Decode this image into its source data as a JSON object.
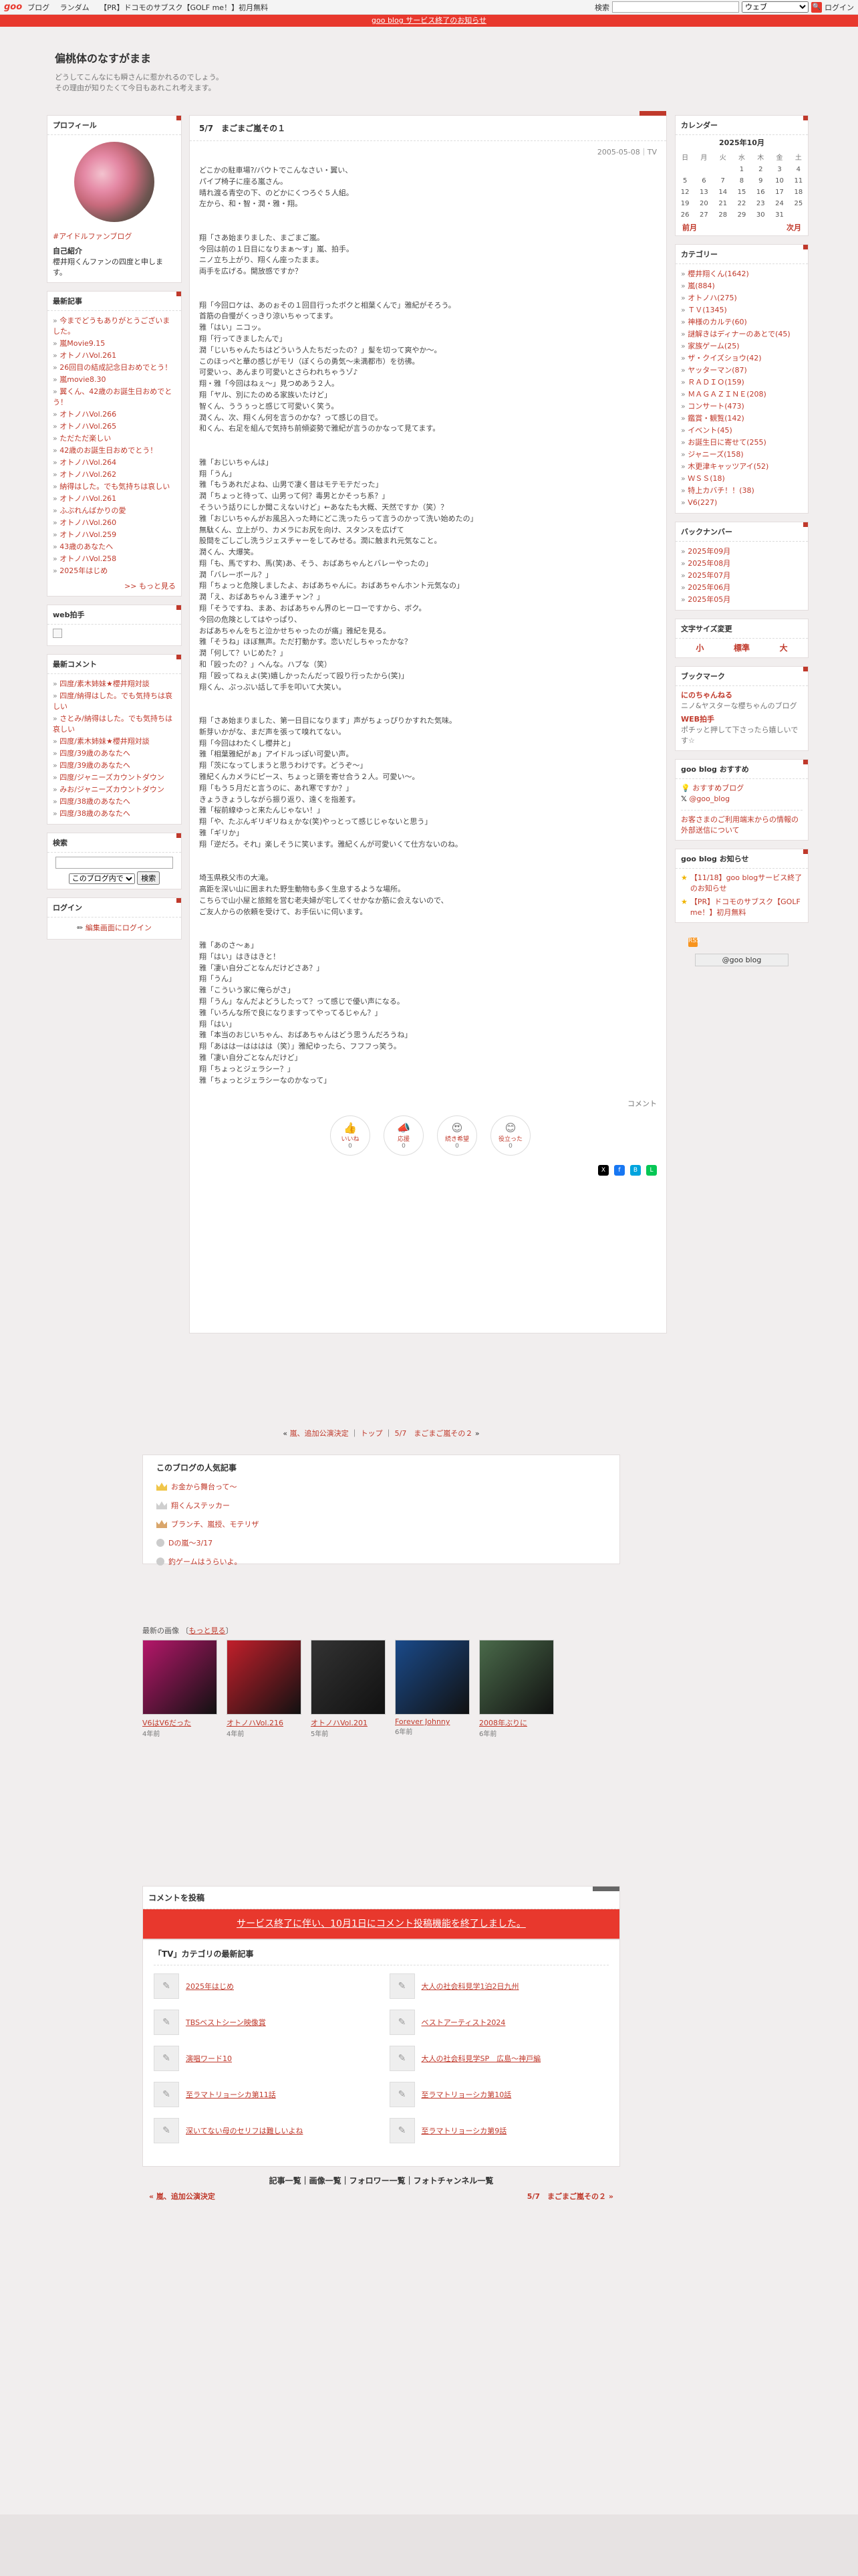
{
  "topbar": {
    "logo": "goo",
    "nav": [
      "ブログ",
      "ランダム",
      "【PR】ドコモのサブスク【GOLF me！】初月無料"
    ],
    "search_label": "検索",
    "search_select": "ウェブ",
    "login": "ログイン"
  },
  "banner": "goo blog サービス終了のお知らせ",
  "blog": {
    "title": "偏桃体のなすがまま",
    "desc1": "どうしてこんなにも瞬さんに惹かれるのでしょう。",
    "desc2": "その理由が知りたくて今日もあれこれ考えます。"
  },
  "profile": {
    "title": "プロフィール",
    "name": "#アイドルファンブログ",
    "intro_label": "自己紹介",
    "intro": "櫻井翔くんファンの四度と申します。"
  },
  "recent": {
    "title": "最新記事",
    "items": [
      "今までどうもありがとうございました。",
      "嵐Movie9.15",
      "オトノハVol.261",
      "26回目の結成記念日おめでとう！",
      "嵐movie8.30",
      "翼くん、42歳のお誕生日おめでとう！",
      "オトノハVol.266",
      "オトノハVol.265",
      "ただただ楽しい",
      "42歳のお誕生日おめでとう！",
      "オトノハVol.264",
      "オトノハVol.262",
      "納得はした。でも気持ちは哀しい",
      "オトノハVol.261",
      "ふぶれんばかりの愛",
      "オトノハVol.260",
      "オトノハVol.259",
      "43歳のあなたへ",
      "オトノハVol.258",
      "2025年はじめ"
    ],
    "more": ">> もっと見る"
  },
  "webclip": {
    "title": "web拍手"
  },
  "comments": {
    "title": "最新コメント",
    "items": [
      "四度/素木姉妹★櫻井翔対談",
      "四度/納得はした。でも気持ちは哀しい",
      "さとみ/納得はした。でも気持ちは哀しい",
      "四度/素木姉妹★櫻井翔対談",
      "四度/39歳のあなたへ",
      "四度/39歳のあなたへ",
      "四度/ジャニーズカウントダウン",
      "みお/ジャニーズカウントダウン",
      "四度/38歳のあなたへ",
      "四度/38歳のあなたへ"
    ]
  },
  "search": {
    "title": "検索",
    "select": "このブログ内で",
    "button": "検索"
  },
  "login": {
    "title": "ログイン",
    "link": "編集画面にログイン"
  },
  "entry": {
    "title": "5/7　まごまご嵐その１",
    "date": "2005-05-08｜TV",
    "lines": [
      "どこかの駐車場?/バウトでこんなさい・翼い、",
      "パイプ椅子に座る嵐さん。",
      "晴れ渡る青空の下、のどかにくつろぐ５人組。",
      "左から、和・智・潤・雅・翔。",
      "",
      "",
      "翔「さあ始まりました、まごまご嵐。",
      "今回は前の１日目になりまぁ～す」嵐、拍手。",
      "ニノ立ち上がり、翔くん座ったまま。",
      "両手を広げる。開放感ですか？",
      "",
      "",
      "翔「今回ロケは、あのぉその１回目行ったボクと相葉くんで」雅紀がそろう。",
      "首筋の自慢がくっきり涼いちゃってます。",
      "雅「はい」ニコッ。",
      "翔「行ってきましたんで」",
      "潤「じいちゃんたちはどういう人たちだったの？」髪を切って爽やか～。",
      "このほっぺと華の感じがモリ（ぼくらの勇気～未満都市）を彷彿。",
      "可愛いっ、あんまり可愛いとさらわれちゃうゾ♪",
      "翔・雅「今回はねぇ～」見つめあう２人。",
      "翔「ヤル、別にたのめる家族いたけど」",
      "智くん、ううぅっと感じて可愛いく笑う。",
      "潤くん、次、翔くん何を言うのかな？って感じの目で。",
      "和くん、右足を組んで気持ち前傾姿勢で雅紀が言うのかなって見てます。",
      "",
      "",
      "雅「おじいちゃんは」",
      "翔「うん」",
      "雅「もうあれだよね、山男で凄く昔はモテモテだった」",
      "潤「ちょっと待って、山男って何？毒男とかそっち系？」",
      "そういう話りにしか聞こえないけど」←あなたも大概、天然ですか（笑）？",
      "雅「おじいちゃんがお風呂入った時にどこ洗ったらって言うのかって洗い始めたの」",
      "無駄くん、立上がり、カメラにお尻を向け、スタンスを広げて",
      "股間をごしごし洗うジェスチャーをしてみせる。潤に触まれ元気なこと。",
      "潤くん、大爆笑。",
      "翔「も、馬ですわ、馬(笑)あ、そう、おばあちゃんとバレーやったの」",
      "潤「バレーボール？」",
      "翔「ちょっと危険しましたよ、おばあちゃんに。おばあちゃんホント元気なの」",
      "潤「え、おばあちゃん３連チャン？」",
      "翔「そうですね、まあ、おばあちゃん界のヒーローですから、ボク。",
      "今回の危険としてはやっぱり、",
      "おばあちゃんをちと泣かせちゃったのが痛」雅紀を見る。",
      "雅「そうね」ほぼ無声。ただ打動かす。恋いだしちゃったかな？",
      "潤「何して？いじめた？」",
      "和「殴ったの？」へんな。ハブな（笑）",
      "翔「殴ってねぇよ(笑)嬉しかったんだって殴り行ったから(笑)」",
      "翔くん、ぷっぷい話して手を叩いて大笑い。",
      "",
      "",
      "翔「さあ始まりました、第一日目になります」声がちょっぴりかすれた気味。",
      "新芽いかがな、まだ声を張って嗅れてない。",
      "翔「今回はわたくし櫻井と」",
      "雅「相葉雅紀がぁ」アイドルっぽい可愛い声。",
      "翔「茨になってしまうと思うわけです。どうぞ～」",
      "雅紀くんカメラにピース、ちょっと頭を寄せ合う２人。可愛い～。",
      "翔「もう５月だと言うのに、あれ寒ですか？」",
      "きょうきょうしながら振り返り、遠くを指差す。",
      "雅「桜前線ゆっと来たんじゃない！」",
      "翔「や、たぶんギリギリねぇかな(笑)やっとって感じじゃないと思う」",
      "雅「ギリか」",
      "翔「逆だろ。それ」楽しそうに笑います。雅紀くんが可愛いくて仕方ないのね。",
      "",
      "",
      "埼玉県秩父市の大滝。",
      "高距を深い山に囲まれた野生動物も多く生息するような場所。",
      "こちらで山小屋と旅館を営む老夫婦が宅してくせかなか筋に会えないので、",
      "ご友人からの依頼を受けて、お手伝いに伺います。",
      "",
      "",
      "雅「あのさ～ぁ」",
      "翔「はい」はきはきと！",
      "雅「凄い自分ごとなんだけどさあ？」",
      "翔「うん」",
      "雅「こういう家に俺らがさ」",
      "翔「うん」なんだよどうしたって？って感じで優い声になる。",
      "雅「いろんな所で良になりますってやってるじゃん？」",
      "翔「はい」",
      "雅「本当のおじいちゃん、おばあちゃんはどう思うんだろうね」",
      "翔「あはは一はははは（笑）」雅紀ゆったら、フフフっ笑う。",
      "雅「凄い自分ごとなんだけど」",
      "翔「ちょっとジェラシー？」",
      "雅「ちょっとジェラシーなのかなって」"
    ],
    "comment_label": "コメント",
    "reactions": [
      {
        "icon": "👍",
        "label": "いいね",
        "count": "0"
      },
      {
        "icon": "📣",
        "label": "応援",
        "count": "0"
      },
      {
        "icon": "😍",
        "label": "続き希望",
        "count": "0"
      },
      {
        "icon": "😊",
        "label": "役立った",
        "count": "0"
      }
    ]
  },
  "entrynav": {
    "prev": "嵐、追加公演決定",
    "top": "トップ",
    "next": "5/7　まごまご嵐その２"
  },
  "popular": {
    "title": "このブログの人気記事",
    "items": [
      "お金から舞台って～",
      "翔くんステッカー",
      "ブランチ、嵐授、モテリザ",
      "Dの嵐～3/17",
      "釣ゲームはうらいよ。"
    ]
  },
  "images": {
    "title": "最新の画像",
    "more": "もっと見る",
    "items": [
      {
        "cap": "V6はV6だった",
        "ago": "4年前"
      },
      {
        "cap": "オトノハVol.216",
        "ago": "4年前"
      },
      {
        "cap": "オトノハVol.201",
        "ago": "5年前"
      },
      {
        "cap": "Forever Johnny",
        "ago": "6年前"
      },
      {
        "cap": "2008年ぶりに",
        "ago": "6年前"
      }
    ]
  },
  "comment": {
    "title": "コメントを投稿",
    "notice": "サービス終了に伴い、10月1日にコメント投稿機能を終了しました。"
  },
  "catlist": {
    "title": "「TV」カテゴリの最新記事",
    "items": [
      "2025年はじめ",
      "大人の社会科見学1泊2日九州",
      "TBSベストシーン映像賞",
      "ベストアーティスト2024",
      "演唱ワード10",
      "大人の社会科見学SP　広島～神戸編",
      "至ラマトリョーシカ第11話",
      "至ラマトリョーシカ第10話",
      "深いてない母のセリフは難しいよね",
      "至ラマトリョーシカ第9話"
    ]
  },
  "footer": {
    "links": "記事一覧｜画像一覧｜フォロワー一覧｜フォトチャンネル一覧",
    "prev": "« 嵐、追加公演決定",
    "next": "5/7　まごまご嵐その２ »"
  },
  "calendar": {
    "title": "カレンダー",
    "month": "2025年10月",
    "days": [
      "日",
      "月",
      "火",
      "水",
      "木",
      "金",
      "土"
    ],
    "weeks": [
      [
        "",
        "",
        "",
        "1",
        "2",
        "3",
        "4"
      ],
      [
        "5",
        "6",
        "7",
        "8",
        "9",
        "10",
        "11"
      ],
      [
        "12",
        "13",
        "14",
        "15",
        "16",
        "17",
        "18"
      ],
      [
        "19",
        "20",
        "21",
        "22",
        "23",
        "24",
        "25"
      ],
      [
        "26",
        "27",
        "28",
        "29",
        "30",
        "31",
        ""
      ]
    ],
    "prev": "前月",
    "next": "次月"
  },
  "categories": {
    "title": "カテゴリー",
    "items": [
      "櫻井翔くん(1642)",
      "嵐(884)",
      "オトノハ(275)",
      "ＴＶ(1345)",
      "神様のカルテ(60)",
      "謎解きはディナーのあとで(45)",
      "家族ゲーム(25)",
      "ザ・クイズショウ(42)",
      "ヤッターマン(87)",
      "ＲＡＤＩＯ(159)",
      "ＭＡＧＡＺＩＮＥ(208)",
      "コンサート(473)",
      "鑑賞・観覧(142)",
      "イベント(45)",
      "お誕生日に寄せて(255)",
      "ジャニーズ(158)",
      "木更津キャッツアイ(52)",
      "ＷＳＳ(18)",
      "特上カバチ！！(38)",
      "V6(227)"
    ]
  },
  "backnumber": {
    "title": "バックナンバー",
    "items": [
      "2025年09月",
      "2025年08月",
      "2025年07月",
      "2025年06月",
      "2025年05月"
    ]
  },
  "fontsize": {
    "title": "文字サイズ変更",
    "options": [
      "小",
      "標準",
      "大"
    ]
  },
  "bookmarks": {
    "title": "ブックマーク",
    "items": [
      {
        "name": "にのちゃんねる",
        "desc": "ニノ&ヤスターな櫻ちゃんのブログ"
      },
      {
        "name": "WEB拍手",
        "desc": "ポチッと押して下さったら嬉しいです☆"
      }
    ]
  },
  "goorec": {
    "title": "goo blog おすすめ",
    "items": [
      "おすすめブログ",
      "@goo_blog"
    ],
    "note": "お客さまのご利用端末からの情報の外部送信について"
  },
  "goonews": {
    "title": "goo blog お知らせ",
    "items": [
      "【11/18】goo blogサービス終了のお知らせ",
      "【PR】ドコモのサブスク【GOLF me！】初月無料"
    ]
  },
  "rss": "RSS",
  "goofooter": "@goo blog"
}
